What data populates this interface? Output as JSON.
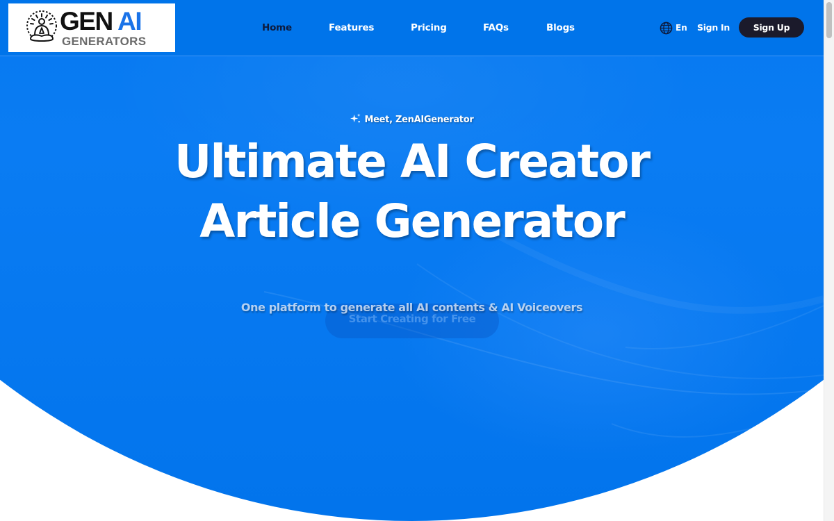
{
  "logo": {
    "main_text": "GEN",
    "accent_text": "AI",
    "sub_text": "GENERATORS",
    "icon": "meditating-person-icon"
  },
  "nav": {
    "items": [
      {
        "label": "Home",
        "active": true
      },
      {
        "label": "Features",
        "active": false
      },
      {
        "label": "Pricing",
        "active": false
      },
      {
        "label": "FAQs",
        "active": false
      },
      {
        "label": "Blogs",
        "active": false
      }
    ]
  },
  "header_actions": {
    "language_icon": "globe-icon",
    "language_label": "En",
    "sign_in_label": "Sign In",
    "sign_up_label": "Sign Up"
  },
  "hero": {
    "eyebrow_icon": "sparkle-icon",
    "eyebrow": "Meet, ZenAIGenerator",
    "title_line_1": "Ultimate AI Creator",
    "title_line_2": "Article Generator",
    "subtitle": "One platform to generate all AI contents & AI Voiceovers",
    "cta_label": "Start Creating for Free"
  },
  "colors": {
    "hero_blue": "#0074ea",
    "logo_accent": "#1a73e8",
    "signup_bg": "#1b1a2b",
    "nav_active": "#0d1b3e"
  }
}
